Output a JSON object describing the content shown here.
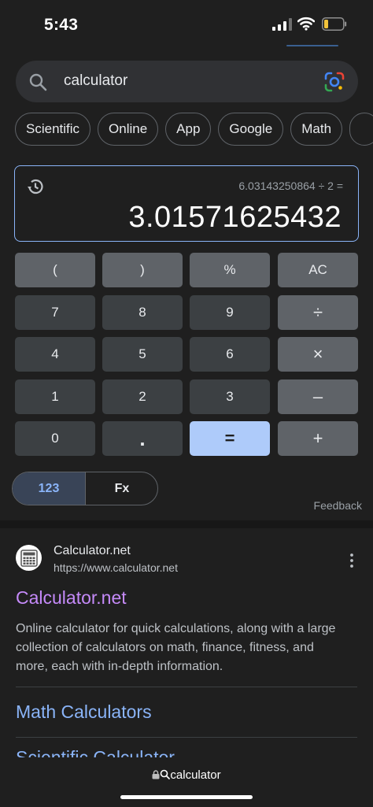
{
  "status": {
    "time": "5:43"
  },
  "search": {
    "query": "calculator"
  },
  "chips": [
    "Scientific",
    "Online",
    "App",
    "Google",
    "Math"
  ],
  "calculator": {
    "expression": "6.03143250864 ÷ 2 =",
    "result": "3.01571625432",
    "keys": [
      "(",
      ")",
      "%",
      "AC",
      "7",
      "8",
      "9",
      "÷",
      "4",
      "5",
      "6",
      "×",
      "1",
      "2",
      "3",
      "–",
      "0",
      ".",
      "=",
      "+"
    ],
    "modes": {
      "basic": "123",
      "function": "Fx",
      "active": "123"
    },
    "feedback": "Feedback"
  },
  "result": {
    "site_name": "Calculator.net",
    "url": "https://www.calculator.net",
    "title": "Calculator.net",
    "snippet": "Online calculator for quick calculations, along with a large collection of calculators on math, finance, fitness, and more, each with in-depth information.",
    "sitelinks": [
      "Math Calculators",
      "Scientific Calculator"
    ]
  },
  "url_bar": {
    "text": "calculator"
  },
  "colors": {
    "link": "#8ab4f8",
    "visited": "#c58af9",
    "equals_key": "#aecbfa"
  }
}
